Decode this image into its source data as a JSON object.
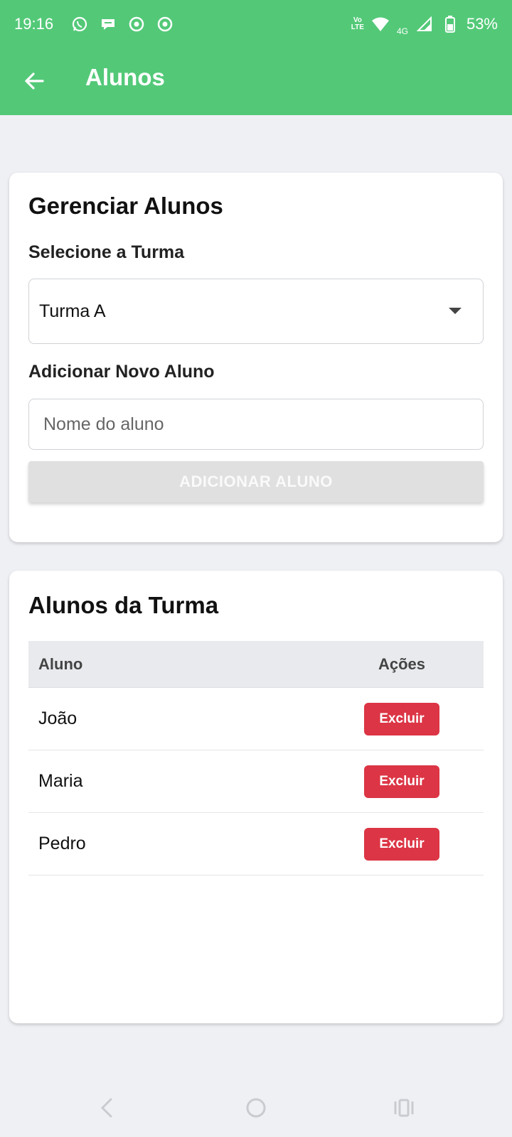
{
  "status_bar": {
    "time": "19:16",
    "battery": "53%",
    "network": "4G",
    "volte_top": "Vo",
    "volte_bottom": "LTE",
    "notification_icons": [
      "whatsapp-icon",
      "chat-bubble-icon",
      "chrome-icon",
      "chrome-icon"
    ]
  },
  "app_bar": {
    "title": "Alunos"
  },
  "manage_card": {
    "title": "Gerenciar Alunos",
    "select_label": "Selecione a Turma",
    "selected_class": "Turma A",
    "add_label": "Adicionar Novo Aluno",
    "name_placeholder": "Nome do aluno",
    "name_value": "",
    "add_button": "ADICIONAR ALUNO"
  },
  "students_card": {
    "title": "Alunos da Turma",
    "columns": [
      "Aluno",
      "Ações"
    ],
    "rows": [
      {
        "name": "João",
        "action": "Excluir"
      },
      {
        "name": "Maria",
        "action": "Excluir"
      },
      {
        "name": "Pedro",
        "action": "Excluir"
      }
    ]
  },
  "colors": {
    "primary": "#53c978",
    "danger": "#dc3545",
    "background": "#eff0f4"
  }
}
